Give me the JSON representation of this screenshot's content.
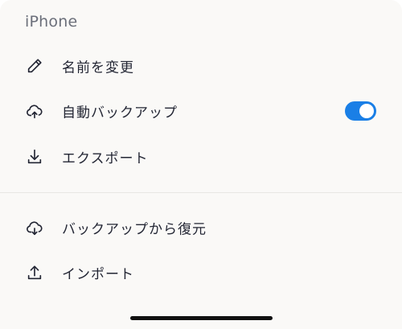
{
  "sheet": {
    "title": "iPhone"
  },
  "menu": {
    "rename": {
      "label": "名前を変更",
      "icon": "pencil-icon"
    },
    "auto_backup": {
      "label": "自動バックアップ",
      "icon": "cloud-upload-icon",
      "enabled": true
    },
    "export": {
      "label": "エクスポート",
      "icon": "download-icon"
    },
    "restore": {
      "label": "バックアップから復元",
      "icon": "cloud-download-icon"
    },
    "import": {
      "label": "インポート",
      "icon": "upload-icon"
    }
  },
  "colors": {
    "accent": "#1a7fe6",
    "background": "#faf9f7",
    "text": "#232634",
    "title": "#6b6f7a"
  }
}
